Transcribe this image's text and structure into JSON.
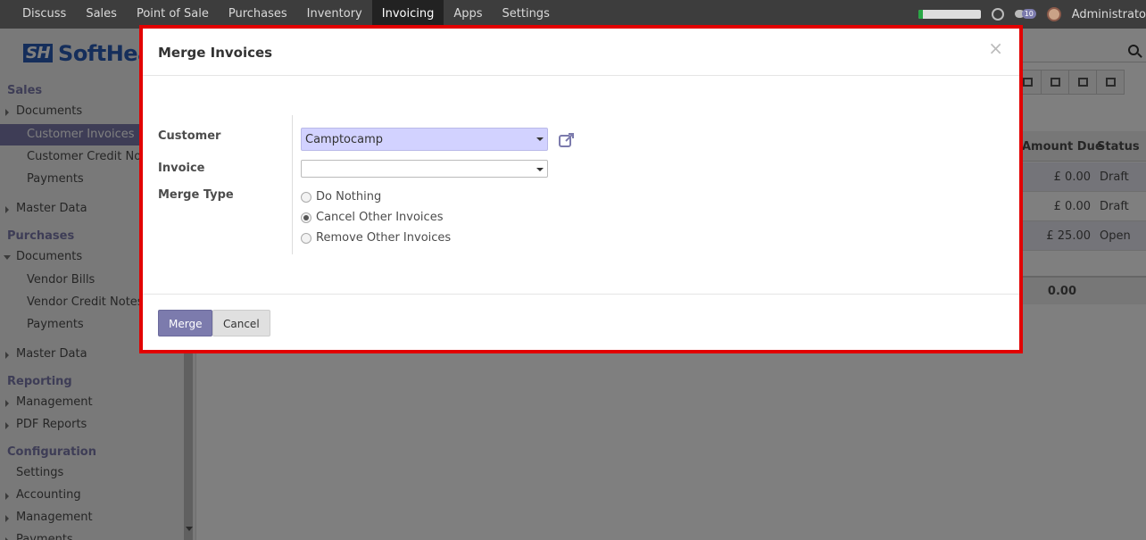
{
  "topnav": {
    "items": [
      "Discuss",
      "Sales",
      "Point of Sale",
      "Purchases",
      "Inventory",
      "Invoicing",
      "Apps",
      "Settings"
    ],
    "active": "Invoicing",
    "notification_count": "10",
    "user": "Administrato"
  },
  "sidebar": {
    "logo": "SoftHea",
    "logo_mark": "SH",
    "sections": {
      "sales": "Sales",
      "purchases": "Purchases",
      "reporting": "Reporting",
      "configuration": "Configuration"
    },
    "items": {
      "sales_documents": "Documents",
      "customer_invoices": "Customer Invoices",
      "customer_credit_notes": "Customer Credit Notes",
      "sales_payments": "Payments",
      "sales_master_data": "Master Data",
      "purchase_documents": "Documents",
      "vendor_bills": "Vendor Bills",
      "vendor_credit_notes": "Vendor Credit Notes",
      "purchase_payments": "Payments",
      "purchase_master_data": "Master Data",
      "management": "Management",
      "pdf_reports": "PDF Reports",
      "settings": "Settings",
      "accounting": "Accounting",
      "config_management": "Management",
      "config_more": "Payments"
    }
  },
  "list": {
    "columns": {
      "amount_due": "Amount Due",
      "status": "Status"
    },
    "rows": [
      {
        "amount_due": "£ 0.00",
        "status": "Draft"
      },
      {
        "amount_due": "£ 0.00",
        "status": "Draft"
      },
      {
        "amount_due": "£ 25.00",
        "status": "Open"
      }
    ],
    "total": "0.00"
  },
  "dialog": {
    "title": "Merge Invoices",
    "close": "×",
    "fields": {
      "customer_label": "Customer",
      "customer_value": "Camptocamp",
      "invoice_label": "Invoice",
      "invoice_value": "",
      "merge_type_label": "Merge Type"
    },
    "merge_options": [
      "Do Nothing",
      "Cancel Other Invoices",
      "Remove Other Invoices"
    ],
    "selected_merge_option": "Cancel Other Invoices",
    "merge_button": "Merge",
    "cancel_button": "Cancel"
  },
  "colors": {
    "accent": "#7c7bad",
    "highlight_border": "#e20000",
    "customer_field_bg": "#d2d2ff",
    "topbar": "#3d3d3d"
  }
}
